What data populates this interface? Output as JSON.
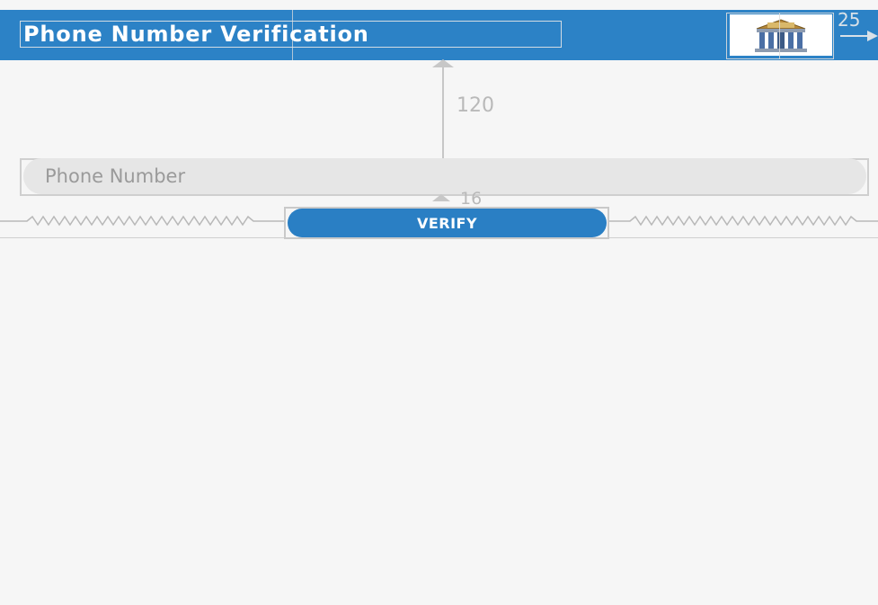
{
  "toolbar": {
    "title": "Phone Number Verification",
    "logo_icon": "bank-icon",
    "bar_color": "#2c82c6"
  },
  "layout_editor": {
    "top_margin_label": "120",
    "button_margin_label": "16",
    "side_margin_label": "25"
  },
  "form": {
    "phone_placeholder": "Phone Number",
    "phone_value": "",
    "verify_label": "VERIFY",
    "button_color": "#2a7fc4"
  }
}
